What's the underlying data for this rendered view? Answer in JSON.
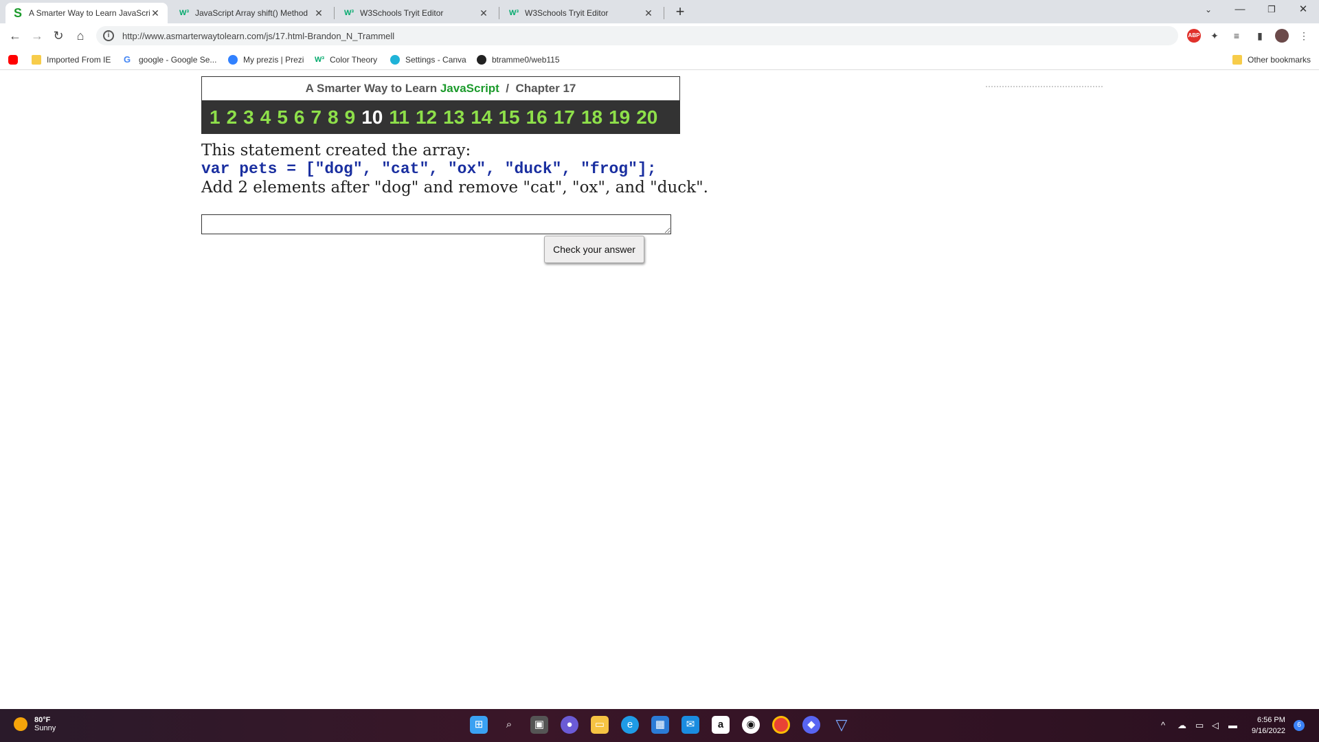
{
  "tabs": [
    {
      "title": "A Smarter Way to Learn JavaScrip",
      "favicon": "S",
      "favicon_color": "#1b9a2b",
      "active": true
    },
    {
      "title": "JavaScript Array shift() Method",
      "favicon": "W3",
      "favicon_color": "#04aa6d",
      "active": false
    },
    {
      "title": "W3Schools Tryit Editor",
      "favicon": "W3",
      "favicon_color": "#04aa6d",
      "active": false
    },
    {
      "title": "W3Schools Tryit Editor",
      "favicon": "W3",
      "favicon_color": "#04aa6d",
      "active": false
    }
  ],
  "address_bar": {
    "url": "http://www.asmarterwaytolearn.com/js/17.html-Brandon_N_Trammell"
  },
  "bookmarks": [
    {
      "label": "",
      "icon": "youtube-icon"
    },
    {
      "label": "Imported From IE",
      "icon": "folder-icon"
    },
    {
      "label": "google - Google Se...",
      "icon": "google-icon"
    },
    {
      "label": "My prezis | Prezi",
      "icon": "prezi-icon"
    },
    {
      "label": "Color Theory",
      "icon": "w3-icon"
    },
    {
      "label": "Settings - Canva",
      "icon": "canva-icon"
    },
    {
      "label": "btramme0/web115",
      "icon": "github-icon"
    }
  ],
  "other_bookmarks": "Other bookmarks",
  "page": {
    "header_prefix": "A Smarter Way to Learn",
    "header_js": "JavaScript",
    "header_sep": "/",
    "header_chapter": "Chapter 17",
    "chapters": [
      "1",
      "2",
      "3",
      "4",
      "5",
      "6",
      "7",
      "8",
      "9",
      "10",
      "11",
      "12",
      "13",
      "14",
      "15",
      "16",
      "17",
      "18",
      "19",
      "20"
    ],
    "current_chapter": "10",
    "statement": "This statement created the array:",
    "code": "var pets = [\"dog\", \"cat\", \"ox\", \"duck\", \"frog\"];",
    "instruction": "Add 2 elements after \"dog\" and remove \"cat\", \"ox\", and \"duck\".",
    "answer_value": "",
    "check_button": "Check your answer"
  },
  "taskbar": {
    "temperature": "80°F",
    "condition": "Sunny",
    "time": "6:56 PM",
    "date": "9/16/2022",
    "notification_count": "6"
  }
}
